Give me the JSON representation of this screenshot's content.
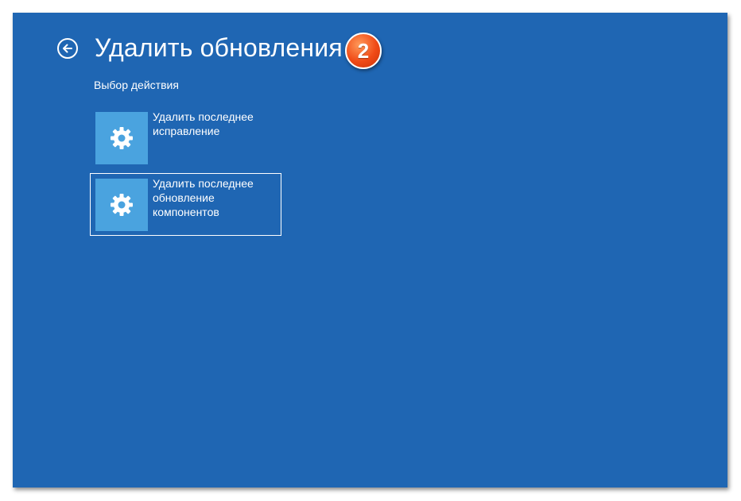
{
  "header": {
    "title": "Удалить обновления",
    "step_badge": "2"
  },
  "subtitle": "Выбор действия",
  "options": [
    {
      "lines": [
        "Удалить последнее",
        "исправление"
      ],
      "icon": "gear-icon",
      "selected": false
    },
    {
      "lines": [
        "Удалить последнее",
        "обновление",
        "компонентов"
      ],
      "icon": "gear-icon",
      "selected": true
    }
  ],
  "colors": {
    "background": "#1f66b3",
    "tile": "#4aa3df",
    "badge": "#f04a16",
    "text": "#ffffff"
  }
}
